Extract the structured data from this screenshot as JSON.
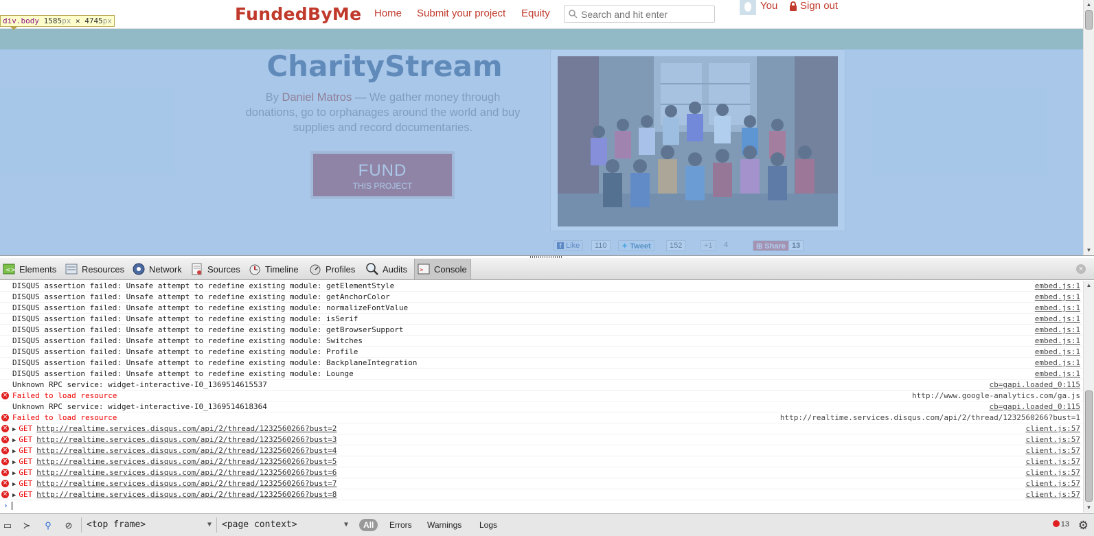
{
  "site": {
    "logo": "FundedByMe",
    "nav": {
      "home": "Home",
      "submit": "Submit your project",
      "equity": "Equity"
    },
    "search_placeholder": "Search and hit enter",
    "user_label": "You",
    "signout_label": "Sign out",
    "project": {
      "title": "CharityStream",
      "by": "By ",
      "author": "Daniel Matros",
      "description": " — We gather money through donations, go to orphanages around the world and buy supplies and record documentaries.",
      "fund_label": "FUND",
      "fund_sublabel": "THIS PROJECT"
    },
    "social": {
      "like_label": "Like",
      "like_count": "110",
      "tweet_label": "Tweet",
      "tweet_count": "152",
      "plusone_label": "+1",
      "plusone_count": "4",
      "share_label": "Share",
      "share_count": "13"
    }
  },
  "inspector_tooltip": {
    "tag": "div.body",
    "width": "1585",
    "height": "4745",
    "unit": "px",
    "times": "×"
  },
  "devtools": {
    "tabs": [
      {
        "label": "Elements",
        "icon": "elements-icon"
      },
      {
        "label": "Resources",
        "icon": "resources-icon"
      },
      {
        "label": "Network",
        "icon": "network-icon"
      },
      {
        "label": "Sources",
        "icon": "sources-icon"
      },
      {
        "label": "Timeline",
        "icon": "timeline-icon"
      },
      {
        "label": "Profiles",
        "icon": "profiles-icon"
      },
      {
        "label": "Audits",
        "icon": "audits-icon"
      },
      {
        "label": "Console",
        "icon": "console-icon",
        "active": true
      }
    ],
    "console": [
      {
        "type": "log",
        "text": "DISQUS assertion failed: Unsafe attempt to redefine existing module: getElementStyle",
        "source": "embed.js:1"
      },
      {
        "type": "log",
        "text": "DISQUS assertion failed: Unsafe attempt to redefine existing module: getAnchorColor",
        "source": "embed.js:1"
      },
      {
        "type": "log",
        "text": "DISQUS assertion failed: Unsafe attempt to redefine existing module: normalizeFontValue",
        "source": "embed.js:1"
      },
      {
        "type": "log",
        "text": "DISQUS assertion failed: Unsafe attempt to redefine existing module: isSerif",
        "source": "embed.js:1"
      },
      {
        "type": "log",
        "text": "DISQUS assertion failed: Unsafe attempt to redefine existing module: getBrowserSupport",
        "source": "embed.js:1"
      },
      {
        "type": "log",
        "text": "DISQUS assertion failed: Unsafe attempt to redefine existing module: Switches",
        "source": "embed.js:1"
      },
      {
        "type": "log",
        "text": "DISQUS assertion failed: Unsafe attempt to redefine existing module: Profile",
        "source": "embed.js:1"
      },
      {
        "type": "log",
        "text": "DISQUS assertion failed: Unsafe attempt to redefine existing module: BackplaneIntegration",
        "source": "embed.js:1"
      },
      {
        "type": "log",
        "text": "DISQUS assertion failed: Unsafe attempt to redefine existing module: Lounge",
        "source": "embed.js:1"
      },
      {
        "type": "log",
        "text": "Unknown RPC service: widget-interactive-I0_1369514615537",
        "source": "cb=gapi.loaded_0:115"
      },
      {
        "type": "error",
        "text": "Failed to load resource",
        "source": "http://www.google-analytics.com/ga.js",
        "plain": true
      },
      {
        "type": "log",
        "text": "Unknown RPC service: widget-interactive-I0_1369514618364",
        "source": "cb=gapi.loaded_0:115"
      },
      {
        "type": "error",
        "text": "Failed to load resource",
        "source": "http://realtime.services.disqus.com/api/2/thread/1232560266?bust=1",
        "plain": true
      },
      {
        "type": "get",
        "method": "GET",
        "text": "http://realtime.services.disqus.com/api/2/thread/1232560266?bust=2",
        "source": "client.js:57"
      },
      {
        "type": "get",
        "method": "GET",
        "text": "http://realtime.services.disqus.com/api/2/thread/1232560266?bust=3",
        "source": "client.js:57"
      },
      {
        "type": "get",
        "method": "GET",
        "text": "http://realtime.services.disqus.com/api/2/thread/1232560266?bust=4",
        "source": "client.js:57"
      },
      {
        "type": "get",
        "method": "GET",
        "text": "http://realtime.services.disqus.com/api/2/thread/1232560266?bust=5",
        "source": "client.js:57"
      },
      {
        "type": "get",
        "method": "GET",
        "text": "http://realtime.services.disqus.com/api/2/thread/1232560266?bust=6",
        "source": "client.js:57"
      },
      {
        "type": "get",
        "method": "GET",
        "text": "http://realtime.services.disqus.com/api/2/thread/1232560266?bust=7",
        "source": "client.js:57"
      },
      {
        "type": "get",
        "method": "GET",
        "text": "http://realtime.services.disqus.com/api/2/thread/1232560266?bust=8",
        "source": "client.js:57"
      }
    ],
    "prompt": "›",
    "statusbar": {
      "frame_select": "<top frame>",
      "context_select": "<page context>",
      "filters": {
        "all": "All",
        "errors": "Errors",
        "warnings": "Warnings",
        "logs": "Logs"
      },
      "error_count": "13"
    }
  }
}
